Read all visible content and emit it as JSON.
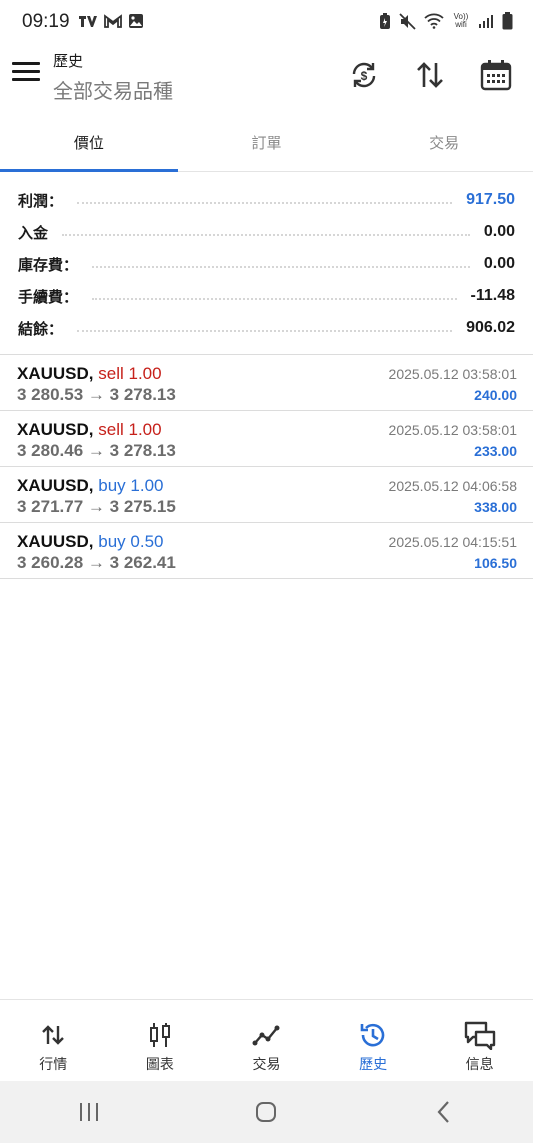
{
  "status_bar": {
    "time": "09:19",
    "left_icons": [
      "tv-icon",
      "gmail-icon",
      "gallery-icon"
    ],
    "right_icons": [
      "battery-saver-icon",
      "mute-icon",
      "wifi-icon",
      "vowifi-icon",
      "signal-icon",
      "battery-icon"
    ],
    "vowifi_text": "Vo)) wifi"
  },
  "header": {
    "title": "歷史",
    "subtitle": "全部交易品種",
    "actions": [
      "sync-icon",
      "sort-icon",
      "calendar-icon"
    ]
  },
  "tabs": [
    {
      "label": "價位",
      "active": true
    },
    {
      "label": "訂單",
      "active": false
    },
    {
      "label": "交易",
      "active": false
    }
  ],
  "summary": [
    {
      "label": "利潤：",
      "value": "917.50",
      "highlight": true
    },
    {
      "label": "入金",
      "value": "0.00",
      "highlight": false
    },
    {
      "label": "庫存費：",
      "value": "0.00",
      "highlight": false
    },
    {
      "label": "手續費：",
      "value": "-11.48",
      "highlight": false
    },
    {
      "label": "結餘：",
      "value": "906.02",
      "highlight": false
    }
  ],
  "trades": [
    {
      "symbol": "XAUUSD,",
      "side": "sell",
      "volume": "1.00",
      "open": "3 280.53",
      "close": "3 278.13",
      "time": "2025.05.12 03:58:01",
      "profit": "240.00"
    },
    {
      "symbol": "XAUUSD,",
      "side": "sell",
      "volume": "1.00",
      "open": "3 280.46",
      "close": "3 278.13",
      "time": "2025.05.12 03:58:01",
      "profit": "233.00"
    },
    {
      "symbol": "XAUUSD,",
      "side": "buy",
      "volume": "1.00",
      "open": "3 271.77",
      "close": "3 275.15",
      "time": "2025.05.12 04:06:58",
      "profit": "338.00"
    },
    {
      "symbol": "XAUUSD,",
      "side": "buy",
      "volume": "0.50",
      "open": "3 260.28",
      "close": "3 262.41",
      "time": "2025.05.12 04:15:51",
      "profit": "106.50"
    }
  ],
  "arrow": "→",
  "bottom_nav": [
    {
      "label": "行情",
      "icon": "quotes-icon",
      "active": false
    },
    {
      "label": "圖表",
      "icon": "chart-icon",
      "active": false
    },
    {
      "label": "交易",
      "icon": "trade-icon",
      "active": false
    },
    {
      "label": "歷史",
      "icon": "history-icon",
      "active": true
    },
    {
      "label": "信息",
      "icon": "messages-icon",
      "active": false
    }
  ],
  "colors": {
    "accent": "#2a6fd6",
    "sell": "#c6201a",
    "buy": "#2a6fd6"
  }
}
